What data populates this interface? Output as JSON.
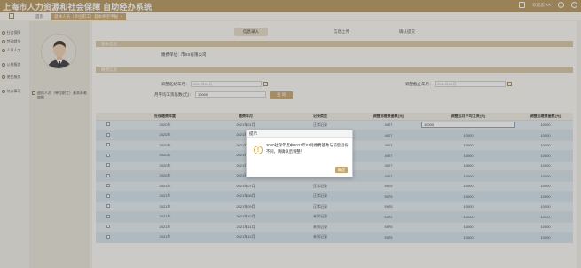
{
  "header": {
    "title": "上海市人力资源和社会保障 自助经办系统",
    "user_label": "欢迎您 XX"
  },
  "tabs": {
    "home_label": "首页",
    "active_label": "退休人员（单位职工）基本养老申报"
  },
  "sidebar": {
    "items": [
      {
        "label": "社会保障",
        "icon": "shield-icon"
      },
      {
        "label": "劳动就业",
        "icon": "briefcase-icon"
      },
      {
        "label": "人事人才",
        "icon": "person-icon"
      },
      {
        "label": "公共服务",
        "icon": "service-icon"
      },
      {
        "label": "便民服务",
        "icon": "help-icon"
      },
      {
        "label": "待办事项",
        "icon": "todo-icon"
      }
    ]
  },
  "profile": {
    "description": "退休人员（单位职工）基本养老申报"
  },
  "steps": [
    "信息录入",
    "信息上传",
    "确认提交"
  ],
  "form": {
    "section1_title": "基本信息",
    "enterprise_label": "缴费单位：",
    "enterprise_value": "市XX有限公司",
    "section2_title": "缴费信息",
    "start_label": "调整起始年月：",
    "start_placeholder": "2021年01月",
    "end_label": "调整截止年月：",
    "end_placeholder": "2021年12月",
    "salary_label": "月平均工资基数(元)：",
    "salary_value": "10000",
    "query_button": "查 询"
  },
  "table": {
    "headers": [
      "",
      "社保缴费年度",
      "缴费年月",
      "记录类型",
      "调整前缴费基数(元)",
      "调整后月平均工资(元)",
      "调整后缴费基数(元)"
    ],
    "rows": [
      {
        "year": "2020年",
        "month": "2021年01月",
        "type": "正常记录",
        "before": "4927",
        "salary": "10000",
        "after": "10000"
      },
      {
        "year": "2020年",
        "month": "2021年02月",
        "type": "正常记录",
        "before": "4927",
        "salary": "10000",
        "after": "10000"
      },
      {
        "year": "2020年",
        "month": "2021年03月",
        "type": "正常记录",
        "before": "4927",
        "salary": "10000",
        "after": "10000"
      },
      {
        "year": "2020年",
        "month": "2021年04月",
        "type": "正常记录",
        "before": "4927",
        "salary": "10000",
        "after": "10000"
      },
      {
        "year": "2020年",
        "month": "2021年05月",
        "type": "正常记录",
        "before": "4927",
        "salary": "10000",
        "after": "10000"
      },
      {
        "year": "2020年",
        "month": "2021年06月",
        "type": "正常记录",
        "before": "4927",
        "salary": "10000",
        "after": "10000"
      },
      {
        "year": "2021年",
        "month": "2021年07月",
        "type": "正常记录",
        "before": "5975",
        "salary": "10000",
        "after": "10000"
      },
      {
        "year": "2021年",
        "month": "2021年08月",
        "type": "正常记录",
        "before": "5975",
        "salary": "10000",
        "after": "10000"
      },
      {
        "year": "2021年",
        "month": "2021年09月",
        "type": "正常记录",
        "before": "5975",
        "salary": "10000",
        "after": "10000"
      },
      {
        "year": "2021年",
        "month": "2021年10月",
        "type": "未到记录",
        "before": "5975",
        "salary": "10000",
        "after": "10000"
      },
      {
        "year": "2021年",
        "month": "2021年11月",
        "type": "未到记录",
        "before": "5975",
        "salary": "10000",
        "after": "10000"
      },
      {
        "year": "2021年",
        "month": "2021年12月",
        "type": "未到记录",
        "before": "5975",
        "salary": "10000",
        "after": "10000"
      }
    ],
    "editing_value": "10000"
  },
  "dialog": {
    "title": "提示",
    "message": "2020社保年度中2021年01月缴费基数与前后月份不同，请确认后调整！",
    "ok_label": "确定"
  },
  "colors": {
    "brand": "#b6955c",
    "accent": "#c9a466",
    "row_blue": "#d3e4ec",
    "warning": "#e0a030"
  }
}
